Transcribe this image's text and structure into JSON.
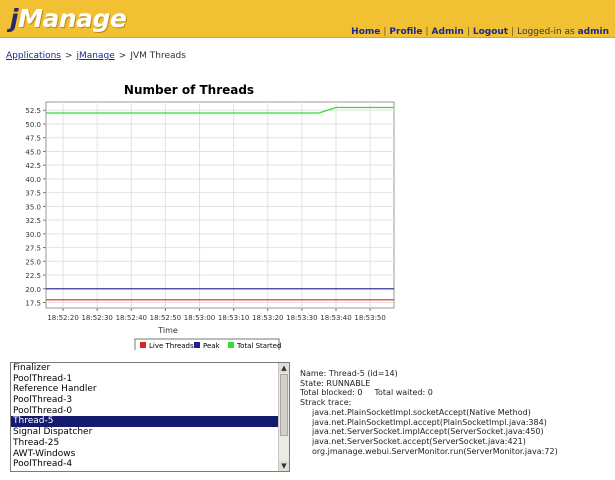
{
  "header": {
    "logo_prefix": "j",
    "logo_rest": "Manage",
    "nav": [
      "Home",
      "Profile",
      "Admin",
      "Logout"
    ],
    "logged_in_text": "Logged-in as",
    "username": "admin",
    "colors": {
      "bar": "#f2c033",
      "link": "#1b2a88"
    }
  },
  "breadcrumb": {
    "items": [
      "Applications",
      "jManage"
    ],
    "current": "JVM Threads",
    "separator": ">"
  },
  "chart_data": {
    "type": "line",
    "title": "Number of Threads",
    "xlabel": "Time",
    "ylabel": "",
    "ylim": [
      16.5,
      54
    ],
    "yticks": [
      17.5,
      20.0,
      22.5,
      25.0,
      27.5,
      30.0,
      32.5,
      35.0,
      37.5,
      40.0,
      42.5,
      45.0,
      47.5,
      50.0,
      52.5
    ],
    "x_ticks": [
      "18:52:20",
      "18:52:30",
      "18:52:40",
      "18:52:50",
      "18:53:00",
      "18:53:10",
      "18:53:20",
      "18:53:30",
      "18:53:40",
      "18:53:50"
    ],
    "x_range": [
      "18:52:15",
      "18:53:57"
    ],
    "grid": true,
    "legend_position": "bottom",
    "series": [
      {
        "name": "Live Threads",
        "color": "#dd2222",
        "points": [
          [
            "18:52:15",
            18.0
          ],
          [
            "18:53:57",
            18.0
          ]
        ]
      },
      {
        "name": "Peak",
        "color": "#22228a",
        "points": [
          [
            "18:52:15",
            20.0
          ],
          [
            "18:53:57",
            20.0
          ]
        ]
      },
      {
        "name": "Total Started",
        "color": "#33dd33",
        "points": [
          [
            "18:52:15",
            52.0
          ],
          [
            "18:53:35",
            52.0
          ],
          [
            "18:53:40",
            53.0
          ],
          [
            "18:53:57",
            53.0
          ]
        ]
      }
    ]
  },
  "threads": {
    "items": [
      "Finalizer",
      "PoolThread-1",
      "Reference Handler",
      "PoolThread-3",
      "PoolThread-0",
      "Thread-5",
      "Signal Dispatcher",
      "Thread-25",
      "AWT-Windows",
      "PoolThread-4"
    ],
    "selected_index": 5
  },
  "scroll": {
    "up": "▲",
    "down": "▼"
  },
  "details": {
    "name_line": "Name: Thread-5 (id=14)",
    "state_line": "State: RUNNABLE",
    "blocked": "Total blocked: 0",
    "waited": "Total waited: 0",
    "stack_label": "Strack trace:",
    "trace": [
      "java.net.PlainSocketImpl.socketAccept(Native Method)",
      "java.net.PlainSocketImpl.accept(PlainSocketImpl.java:384)",
      "java.net.ServerSocket.implAccept(ServerSocket.java:450)",
      "java.net.ServerSocket.accept(ServerSocket.java:421)",
      "org.jmanage.webui.ServerMonitor.run(ServerMonitor.java:72)"
    ]
  }
}
